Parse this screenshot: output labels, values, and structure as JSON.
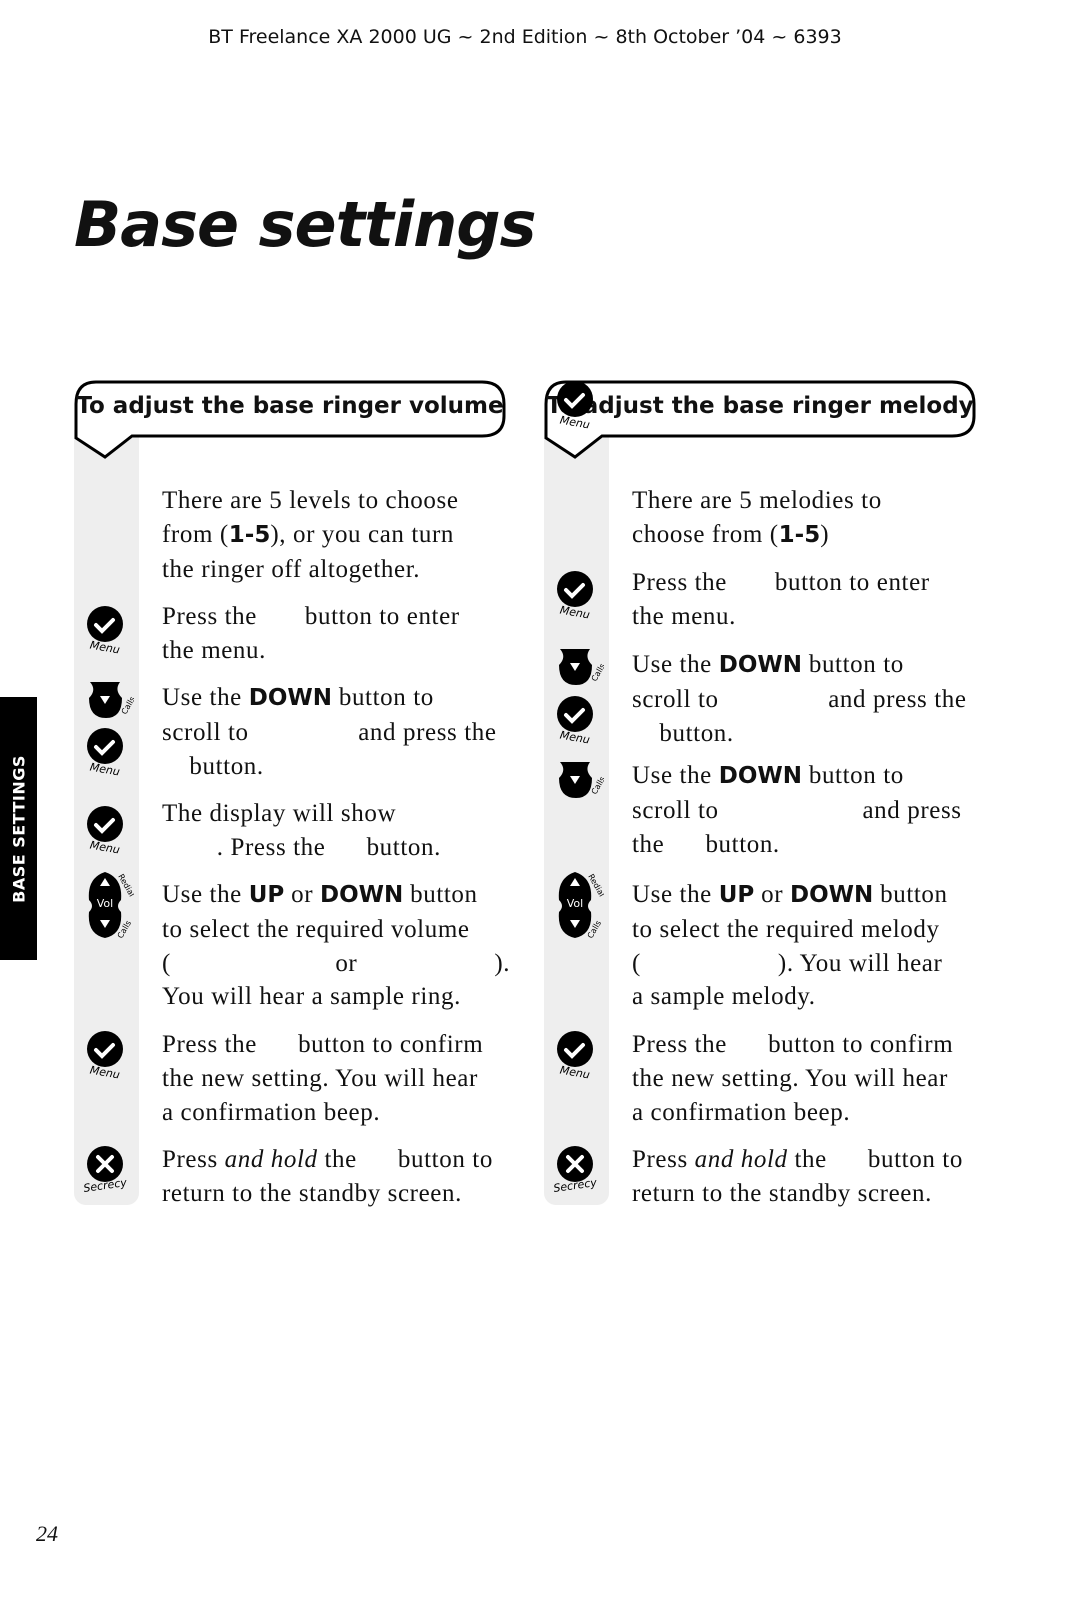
{
  "header": "BT Freelance XA 2000 UG ~ 2nd Edition ~ 8th October ’04 ~ 6393",
  "title": "Base settings",
  "side_tab": "BASE SETTINGS",
  "page_number": "24",
  "columns": [
    {
      "heading": "To adjust the base ringer volume",
      "steps": [
        {
          "icons": [],
          "lines": [
            [
              [
                "There are 5 levels to choose",
                ""
              ]
            ],
            [
              [
                "from (",
                ""
              ],
              [
                "1-5",
                "b"
              ],
              [
                "), or you can turn",
                ""
              ]
            ],
            [
              [
                "the ringer off altogether.",
                ""
              ]
            ]
          ]
        },
        {
          "icons": [
            "menu"
          ],
          "lines": [
            [
              [
                "Press the       button to enter",
                ""
              ]
            ],
            [
              [
                "the menu.",
                ""
              ]
            ]
          ]
        },
        {
          "icons": [
            "down",
            "menu"
          ],
          "lines": [
            [
              [
                "Use the ",
                ""
              ],
              [
                "DOWN",
                "b"
              ],
              [
                " button to",
                ""
              ]
            ],
            [
              [
                "scroll to                and press the",
                ""
              ]
            ],
            [
              [
                "    button.",
                ""
              ]
            ]
          ]
        },
        {
          "icons": [
            "menu"
          ],
          "lines": [
            [
              [
                "The display will show",
                ""
              ]
            ],
            [
              [
                "        . Press the      button.",
                ""
              ]
            ]
          ]
        },
        {
          "icons": [
            "vol"
          ],
          "lines": [
            [
              [
                "Use the ",
                ""
              ],
              [
                "UP",
                "b"
              ],
              [
                " or ",
                ""
              ],
              [
                "DOWN",
                "b"
              ],
              [
                " button",
                ""
              ]
            ],
            [
              [
                "to select the required volume",
                ""
              ]
            ],
            [
              [
                "(                        or                    ).",
                ""
              ]
            ],
            [
              [
                "You will hear a sample ring.",
                ""
              ]
            ]
          ]
        },
        {
          "icons": [
            "menu"
          ],
          "lines": [
            [
              [
                "Press the      button to confirm",
                ""
              ]
            ],
            [
              [
                "the new setting. You will hear",
                ""
              ]
            ],
            [
              [
                "a confirmation beep.",
                ""
              ]
            ]
          ]
        },
        {
          "icons": [
            "secrecy"
          ],
          "lines": [
            [
              [
                "Press ",
                ""
              ],
              [
                "and hold",
                "i"
              ],
              [
                " the      button to",
                ""
              ]
            ],
            [
              [
                "return to the standby screen.",
                ""
              ]
            ]
          ]
        }
      ]
    },
    {
      "heading": "To adjust the base ringer melody",
      "steps": [
        {
          "icons": [],
          "lines": [
            [
              [
                "There are 5 melodies to",
                ""
              ]
            ],
            [
              [
                "choose from (",
                ""
              ],
              [
                "1-5",
                "b"
              ],
              [
                ")",
                ""
              ]
            ]
          ]
        },
        {
          "icons": [
            "menu"
          ],
          "lines": [
            [
              [
                "Press the       button to enter",
                ""
              ]
            ],
            [
              [
                "the menu.",
                ""
              ]
            ]
          ]
        },
        {
          "icons": [
            "down",
            "menu"
          ],
          "lines": [
            [
              [
                "Use the ",
                ""
              ],
              [
                "DOWN",
                "b"
              ],
              [
                " button to",
                ""
              ]
            ],
            [
              [
                "scroll to                and press the",
                ""
              ]
            ],
            [
              [
                "    button.",
                ""
              ]
            ]
          ]
        },
        {
          "icons": [
            "down",
            "menu"
          ],
          "lines": [
            [
              [
                "Use the ",
                ""
              ],
              [
                "DOWN",
                "b"
              ],
              [
                " button to",
                ""
              ]
            ],
            [
              [
                "scroll to                     and press",
                ""
              ]
            ],
            [
              [
                "the      button.",
                ""
              ]
            ]
          ]
        },
        {
          "icons": [
            "vol"
          ],
          "lines": [
            [
              [
                "Use the ",
                ""
              ],
              [
                "UP",
                "b"
              ],
              [
                " or ",
                ""
              ],
              [
                "DOWN",
                "b"
              ],
              [
                " button",
                ""
              ]
            ],
            [
              [
                "to select the required melody",
                ""
              ]
            ],
            [
              [
                "(                    ). You will hear",
                ""
              ]
            ],
            [
              [
                "a sample melody.",
                ""
              ]
            ]
          ]
        },
        {
          "icons": [
            "menu"
          ],
          "lines": [
            [
              [
                "Press the      button to confirm",
                ""
              ]
            ],
            [
              [
                "the new setting. You will hear",
                ""
              ]
            ],
            [
              [
                "a confirmation beep.",
                ""
              ]
            ]
          ]
        },
        {
          "icons": [
            "secrecy"
          ],
          "lines": [
            [
              [
                "Press ",
                ""
              ],
              [
                "and hold",
                "i"
              ],
              [
                " the      button to",
                ""
              ]
            ],
            [
              [
                "return to the standby screen.",
                ""
              ]
            ]
          ]
        }
      ]
    }
  ],
  "icon_labels": {
    "menu": "Menu",
    "secrecy": "Secrecy",
    "vol": "Vol",
    "redial": "Redial",
    "calls": "Calls"
  }
}
